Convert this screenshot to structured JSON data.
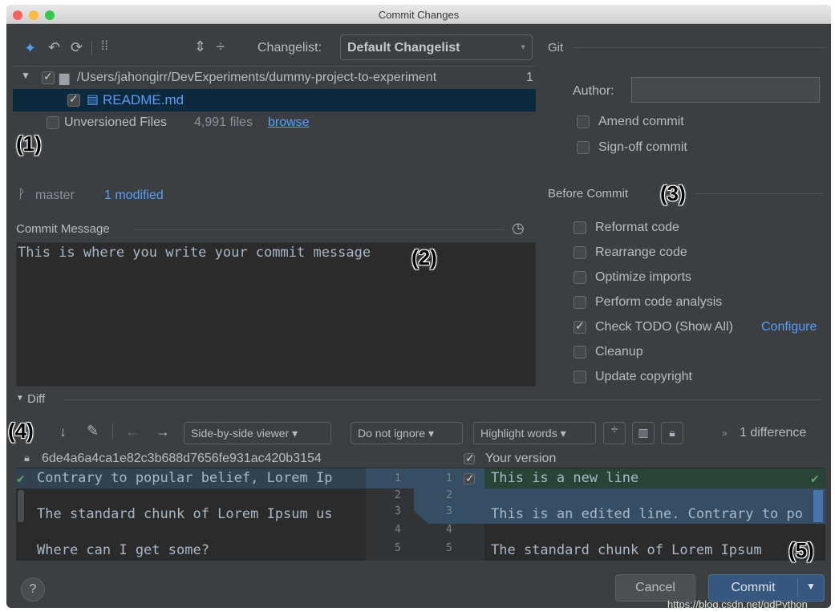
{
  "window": {
    "title": "Commit Changes"
  },
  "toolbar": {
    "changelist_label": "Changelist:",
    "changelist_value": "Default Changelist"
  },
  "tree": {
    "root_path": "/Users/jahongirr/DevExperiments/dummy-project-to-experiment",
    "root_count": "1",
    "file_name": "README.md",
    "unversioned_label": "Unversioned Files",
    "unversioned_count": "4,991 files",
    "browse_link": "browse"
  },
  "branch": {
    "name": "master",
    "status": "1 modified"
  },
  "commit_message": {
    "header": "Commit Message",
    "text": "This is where you write your commit message"
  },
  "git": {
    "header": "Git",
    "author_label": "Author:",
    "author_value": "",
    "amend": "Amend commit",
    "signoff": "Sign-off commit"
  },
  "before_commit": {
    "header": "Before Commit",
    "options": [
      {
        "label": "Reformat code",
        "checked": false
      },
      {
        "label": "Rearrange code",
        "checked": false
      },
      {
        "label": "Optimize imports",
        "checked": false
      },
      {
        "label": "Perform code analysis",
        "checked": false
      },
      {
        "label": "Check TODO (Show All)",
        "checked": true
      },
      {
        "label": "Cleanup",
        "checked": false
      },
      {
        "label": "Update copyright",
        "checked": false
      }
    ],
    "configure_link": "Configure"
  },
  "diff": {
    "header": "Diff",
    "viewer_dropdown": "Side-by-side viewer",
    "ignore_dropdown": "Do not ignore",
    "highlight_dropdown": "Highlight words",
    "difference_count": "1 difference",
    "left_revision": "6de4a6a4ca1e82c3b688d7656fe931ac420b3154",
    "right_title": "Your version",
    "left_lines": [
      "Contrary to popular belief, Lorem Ip",
      "The standard chunk of Lorem Ipsum us",
      "Where can I get some?"
    ],
    "right_lines": [
      "This is a new line",
      "This is an edited line. Contrary to po",
      "The standard chunk of Lorem Ipsum"
    ],
    "left_numbers": [
      "1",
      "2",
      "3",
      "4",
      "5"
    ],
    "right_numbers": [
      "1",
      "2",
      "3",
      "4",
      "5"
    ]
  },
  "footer": {
    "help": "?",
    "cancel": "Cancel",
    "commit": "Commit",
    "watermark": "https://blog.csdn.net/gdPython"
  },
  "annotations": [
    "(1)",
    "(2)",
    "(3)",
    "(4)",
    "(5)"
  ],
  "colors": {
    "background": "#3c3f41",
    "editor": "#2b2b2b",
    "selection": "#0d293e",
    "link": "#589df6",
    "added": "#294436",
    "modified": "#385570",
    "primary_button": "#365880"
  }
}
